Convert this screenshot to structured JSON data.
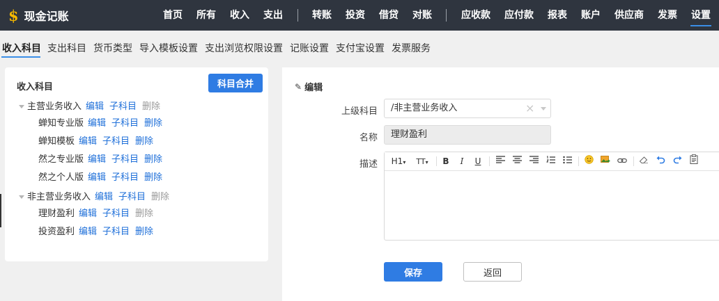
{
  "app": {
    "logo_glyph": "$",
    "title": "现金记账"
  },
  "nav": {
    "items": [
      "首页",
      "所有",
      "收入",
      "支出",
      "转账",
      "投资",
      "借贷",
      "对账",
      "应收款",
      "应付款",
      "报表",
      "账户",
      "供应商",
      "发票",
      "设置"
    ],
    "active": "设置"
  },
  "subtabs": {
    "items": [
      "收入科目",
      "支出科目",
      "货币类型",
      "导入模板设置",
      "支出浏览权限设置",
      "记账设置",
      "支付宝设置",
      "发票服务"
    ],
    "active": "收入科目"
  },
  "left": {
    "title": "收入科目",
    "merge_button": "科目合并",
    "actions": {
      "edit": "编辑",
      "child": "子科目",
      "delete": "删除"
    },
    "tree": [
      {
        "label": "主营业务收入",
        "level": 0,
        "delete_enabled": false
      },
      {
        "label": "蝉知专业版",
        "level": 1,
        "delete_enabled": true
      },
      {
        "label": "蝉知模板",
        "level": 1,
        "delete_enabled": true
      },
      {
        "label": "然之专业版",
        "level": 1,
        "delete_enabled": true
      },
      {
        "label": "然之个人版",
        "level": 1,
        "delete_enabled": true
      },
      {
        "label": "非主营业务收入",
        "level": 0,
        "delete_enabled": false
      },
      {
        "label": "理财盈利",
        "level": 1,
        "delete_enabled": false
      },
      {
        "label": "投资盈利",
        "level": 1,
        "delete_enabled": true
      }
    ]
  },
  "form": {
    "heading": "编辑",
    "parent_label": "上级科目",
    "parent_value": "/非主营业务收入",
    "name_label": "名称",
    "name_value": "理财盈利",
    "desc_label": "描述",
    "desc_value": "",
    "toolbar": {
      "heading": "H1",
      "font_size": "TT",
      "bold": "B",
      "italic": "I",
      "underline": "U"
    },
    "save_button": "保存",
    "back_button": "返回"
  },
  "colors": {
    "topbar": "#2f353f",
    "accent": "#2f7ce3",
    "link": "#1e6fd9",
    "disabled": "#9a9a9a",
    "logo": "#f5b800"
  }
}
